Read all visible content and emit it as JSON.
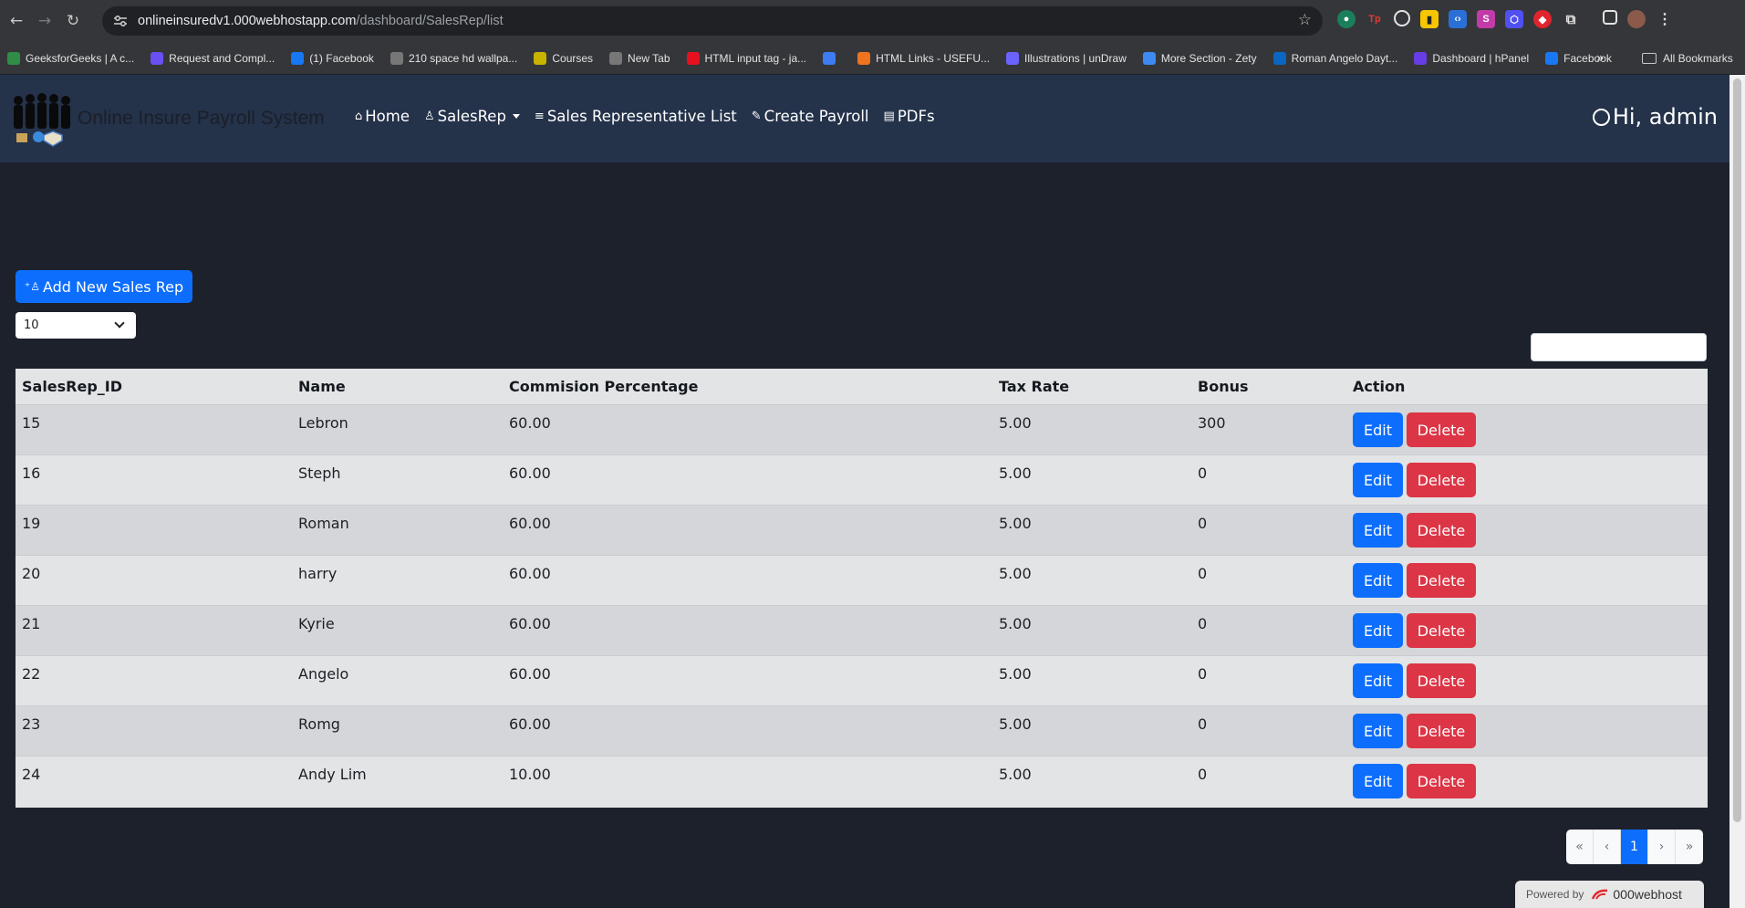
{
  "browser": {
    "url_host": "onlineinsuredv1.000webhostapp.com",
    "url_path": "/dashboard/SalesRep/list",
    "bookmarks": [
      {
        "label": "GeeksforGeeks | A c...",
        "color": "#2f8d46",
        "icon": "gfg-icon"
      },
      {
        "label": "Request and Compl...",
        "color": "#6a4ff2",
        "icon": "list-icon"
      },
      {
        "label": "(1) Facebook",
        "color": "#1877f2",
        "icon": "facebook-icon"
      },
      {
        "label": "210 space hd wallpa...",
        "color": "#777777",
        "icon": "globe-icon"
      },
      {
        "label": "Courses",
        "color": "#c9b200",
        "icon": "courses-icon"
      },
      {
        "label": "New Tab",
        "color": "#777777",
        "icon": "globe-icon"
      },
      {
        "label": "HTML input tag - ja...",
        "color": "#e8101e",
        "icon": "html-icon"
      },
      {
        "label": "",
        "color": "#3d7cf2",
        "icon": "table-icon"
      },
      {
        "label": "HTML Links - USEFU...",
        "color": "#f0731e",
        "icon": "links-icon"
      },
      {
        "label": "Illustrations | unDraw",
        "color": "#6c63ff",
        "icon": "undraw-icon"
      },
      {
        "label": "More Section - Zety",
        "color": "#3d8bf2",
        "icon": "zety-icon"
      },
      {
        "label": "Roman Angelo Dayt...",
        "color": "#0a66c2",
        "icon": "linkedin-icon"
      },
      {
        "label": "Dashboard | hPanel",
        "color": "#673de6",
        "icon": "hpanel-icon"
      },
      {
        "label": "Facebook",
        "color": "#1877f2",
        "icon": "facebook-icon"
      }
    ],
    "all_bookmarks": "All Bookmarks",
    "more": "»"
  },
  "nav": {
    "brand": "Online Insure Payroll System",
    "items": [
      {
        "icon": "⌂",
        "label": "Home"
      },
      {
        "icon": "♙",
        "label": "SalesRep",
        "dropdown": true
      },
      {
        "icon": "≡",
        "label": "Sales Representative List"
      },
      {
        "icon": "✎",
        "label": "Create Payroll"
      },
      {
        "icon": "▤",
        "label": "PDFs"
      }
    ],
    "greeting": "Hi, admin"
  },
  "content": {
    "add_button": "Add New Sales Rep",
    "page_length": "10",
    "search_value": ""
  },
  "table": {
    "headers": [
      "SalesRep_ID",
      "Name",
      "Commision Percentage",
      "Tax Rate",
      "Bonus",
      "Action"
    ],
    "rows": [
      {
        "id": "15",
        "name": "Lebron",
        "commission": "60.00",
        "tax": "5.00",
        "bonus": "300"
      },
      {
        "id": "16",
        "name": "Steph",
        "commission": "60.00",
        "tax": "5.00",
        "bonus": "0"
      },
      {
        "id": "19",
        "name": "Roman",
        "commission": "60.00",
        "tax": "5.00",
        "bonus": "0"
      },
      {
        "id": "20",
        "name": "harry",
        "commission": "60.00",
        "tax": "5.00",
        "bonus": "0"
      },
      {
        "id": "21",
        "name": "Kyrie",
        "commission": "60.00",
        "tax": "5.00",
        "bonus": "0"
      },
      {
        "id": "22",
        "name": "Angelo",
        "commission": "60.00",
        "tax": "5.00",
        "bonus": "0"
      },
      {
        "id": "23",
        "name": "Romg",
        "commission": "60.00",
        "tax": "5.00",
        "bonus": "0"
      },
      {
        "id": "24",
        "name": "Andy Lim",
        "commission": "10.00",
        "tax": "5.00",
        "bonus": "0"
      }
    ],
    "edit_label": "Edit",
    "delete_label": "Delete"
  },
  "pagination": [
    "«",
    "‹",
    "1",
    "›",
    "»"
  ],
  "pagination_active": "1",
  "footer": {
    "powered_by": "Powered by",
    "host": "000webhost"
  },
  "colors": {
    "primary": "#0d6efd",
    "danger": "#dc3545",
    "navbar": "#24324a",
    "background": "#1c212b"
  }
}
